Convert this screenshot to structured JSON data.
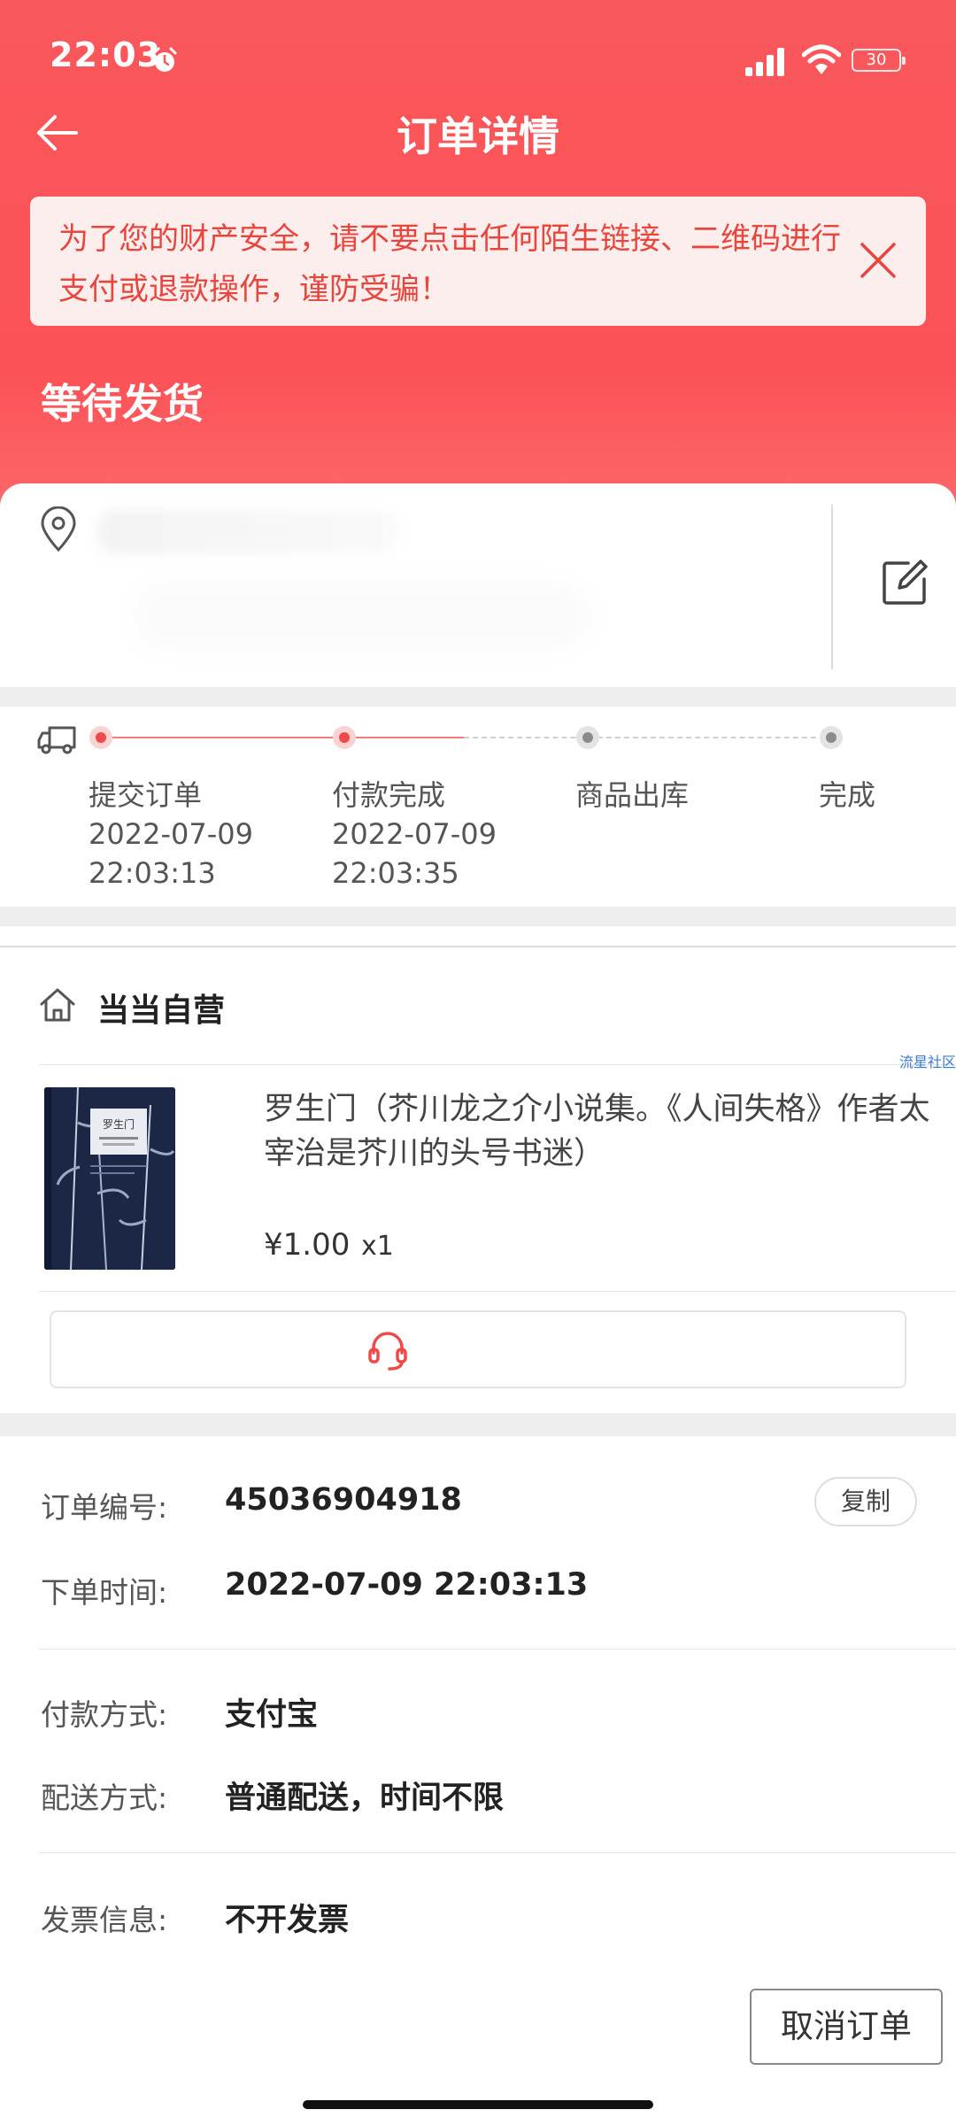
{
  "status_bar": {
    "time": "22:03",
    "battery": "30"
  },
  "nav": {
    "title": "订单详情"
  },
  "warning": {
    "text": "为了您的财产安全，请不要点击任何陌生链接、二维码进行支付或退款操作，谨防受骗！"
  },
  "order_status": "等待发货",
  "progress": {
    "steps": [
      {
        "label": "提交订单",
        "date": "2022-07-09",
        "time": "22:03:13",
        "done": true
      },
      {
        "label": "付款完成",
        "date": "2022-07-09",
        "time": "22:03:35",
        "done": true
      },
      {
        "label": "商品出库",
        "date": "",
        "time": "",
        "done": false
      },
      {
        "label": "完成",
        "date": "",
        "time": "",
        "done": false
      }
    ]
  },
  "store": {
    "name": "当当自营",
    "watermark": "流星社区"
  },
  "product": {
    "title": "罗生门（芥川龙之介小说集。《人间失格》作者太宰治是芥川的头号书迷）",
    "price": "¥1.00",
    "quantity": "x1",
    "cover_title": "罗生门"
  },
  "order_info": {
    "order_no_label": "订单编号:",
    "order_no": "45036904918",
    "copy_label": "复制",
    "order_time_label": "下单时间:",
    "order_time": "2022-07-09 22:03:13",
    "payment_label": "付款方式:",
    "payment": "支付宝",
    "delivery_label": "配送方式:",
    "delivery": "普通配送，时间不限",
    "invoice_label": "发票信息:",
    "invoice": "不开发票"
  },
  "actions": {
    "cancel_label": "取消订单"
  },
  "colors": {
    "header_red": "#fb5257",
    "accent_red": "#f0494a",
    "warning_bg": "#fdeeee"
  }
}
